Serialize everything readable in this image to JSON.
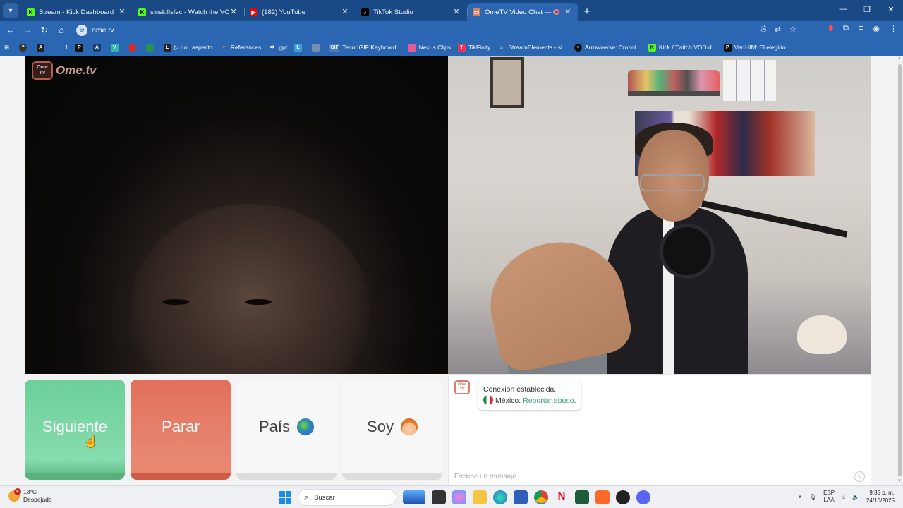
{
  "browser": {
    "tabs": [
      {
        "title": "Stream - Kick Dashboard",
        "favicon": "kick-icon",
        "active": false
      },
      {
        "title": "sinskillsfec - Watch the VOD on",
        "favicon": "kick-icon",
        "active": false
      },
      {
        "title": "(182) YouTube",
        "favicon": "youtube-icon",
        "active": false
      },
      {
        "title": "TikTok Studio",
        "favicon": "tiktok-icon",
        "active": false
      },
      {
        "title": "OmeTV Video Chat — Ome",
        "favicon": "ometv-icon",
        "active": true
      }
    ],
    "url": "ome.tv",
    "bookmarks": [
      {
        "label": "",
        "icon": "circle-icon"
      },
      {
        "label": "",
        "icon": "a-icon"
      },
      {
        "label": "1",
        "icon": "bookmark-icon"
      },
      {
        "label": "",
        "icon": "p-icon"
      },
      {
        "label": "",
        "icon": "af-icon"
      },
      {
        "label": "",
        "icon": "v-icon"
      },
      {
        "label": "",
        "icon": "red-dot-icon"
      },
      {
        "label": "",
        "icon": "green-icon"
      },
      {
        "label": "▷ LoL aspecto",
        "icon": "l-icon"
      },
      {
        "label": "References",
        "icon": "heart-icon"
      },
      {
        "label": "gpt",
        "icon": "gpt-icon"
      },
      {
        "label": "",
        "icon": "l-icon"
      },
      {
        "label": "",
        "icon": "image-icon"
      },
      {
        "label": "Tenor GIF Keyboard...",
        "icon": "gif-icon"
      },
      {
        "label": "Nexus Clips",
        "icon": "nexus-icon"
      },
      {
        "label": "TikFinity",
        "icon": "tikfinity-icon"
      },
      {
        "label": "StreamElements - si...",
        "icon": "streamelements-icon"
      },
      {
        "label": "Arrowverse: Cronol...",
        "icon": "arrow-icon"
      },
      {
        "label": "Kick / Twitch VOD d...",
        "icon": "kick-icon"
      },
      {
        "label": "Ver HIM: El elegido...",
        "icon": "p-icon"
      }
    ]
  },
  "ometv": {
    "logo_text": "Ome.tv",
    "logo_badge": "Ome TV",
    "buttons": {
      "next": "Siguiente",
      "stop": "Parar",
      "country": "País",
      "gender": "Soy"
    },
    "chat": {
      "status": "Conexión establecida.",
      "country": "México.",
      "report_link": "Reportar abuso",
      "report_suffix": ".",
      "input_placeholder": "Escribe un mensaje"
    }
  },
  "taskbar": {
    "temperature": "13°C",
    "weather": "Despejado",
    "weather_badge": "4",
    "search": "Buscar",
    "language_top": "ESP",
    "language_bottom": "LAA",
    "time": "9:35 p. m.",
    "date": "24/10/2025"
  },
  "colors": {
    "next": "#7dd6a5",
    "stop": "#e57a63",
    "browser_frame": "#2b66b3",
    "link": "#3aa57a"
  }
}
